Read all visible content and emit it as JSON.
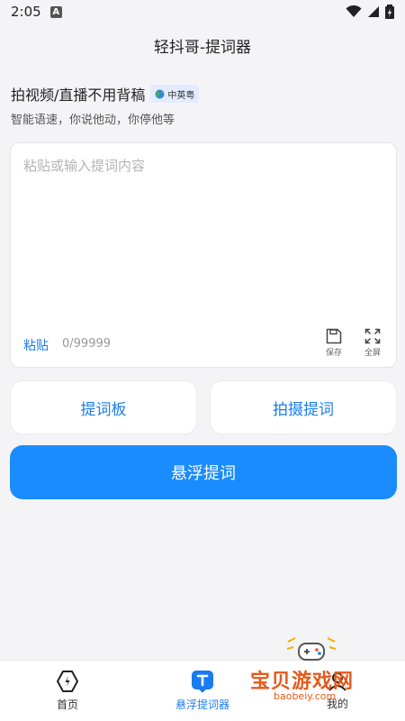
{
  "status_bar": {
    "time": "2:05",
    "notif_letter": "A"
  },
  "app": {
    "title": "轻抖哥-提词器"
  },
  "headline": {
    "text": "拍视频/直播不用背稿",
    "badge": "中英粤",
    "subtitle": "智能语速，你说他动，你停他等"
  },
  "editor": {
    "placeholder": "粘贴或输入提词内容",
    "paste_label": "粘贴",
    "char_count": "0/99999",
    "save_label": "保存",
    "fullscreen_label": "全屏"
  },
  "actions": {
    "board_label": "提词板",
    "shoot_label": "拍摄提词",
    "float_label": "悬浮提词"
  },
  "nav": {
    "items": [
      {
        "label": "首页",
        "icon": "home-icon"
      },
      {
        "label": "悬浮提词器",
        "icon": "teleprompter-icon",
        "active": true
      },
      {
        "label": "我的",
        "icon": "profile-icon"
      }
    ]
  },
  "watermark": {
    "text": "宝贝游戏网",
    "url": "baobeiy.com"
  },
  "colors": {
    "accent": "#1a7cf0",
    "primary_button": "#1b8cff",
    "background": "#f4f4f6"
  }
}
